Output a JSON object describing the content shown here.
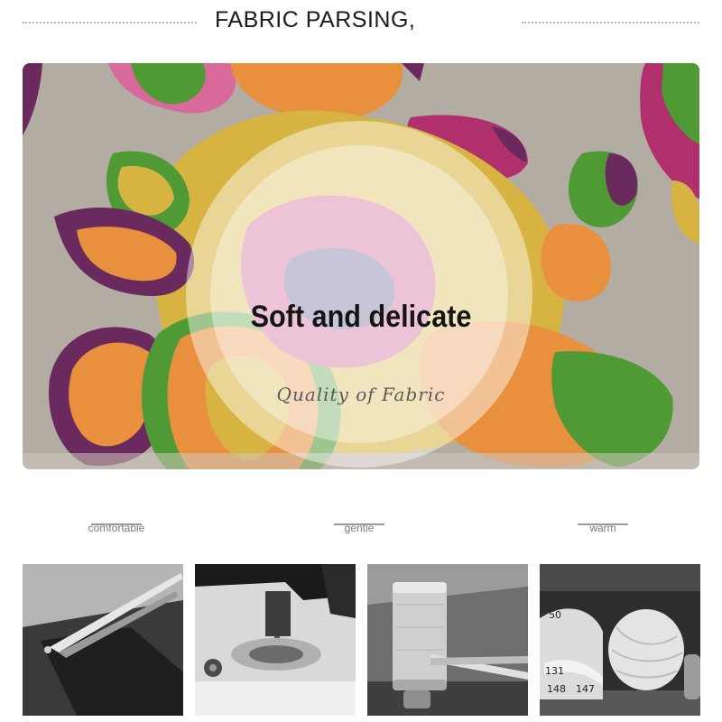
{
  "header": {
    "title": "FABRIC PARSING,"
  },
  "hero": {
    "headline": "Soft and delicate",
    "subtitle": "Quality of Fabric"
  },
  "features": [
    {
      "label": "comfortable"
    },
    {
      "label": "gentle"
    },
    {
      "label": "warm"
    }
  ],
  "tiles": [
    {
      "icon": "scissors-cutting-fabric-image"
    },
    {
      "icon": "sewing-machine-image"
    },
    {
      "icon": "thread-spool-and-snips-image"
    },
    {
      "icon": "measuring-tape-and-twine-image",
      "tape_numbers": [
        "50",
        "131",
        "147",
        "148"
      ]
    }
  ],
  "colors": {
    "fabric_gray": "#b3aca3",
    "magenta": "#b0306e",
    "purple": "#6a2a5e",
    "orange": "#e8903e",
    "yellow": "#d7b441",
    "green": "#4f9a35",
    "pink": "#d76a9a"
  }
}
